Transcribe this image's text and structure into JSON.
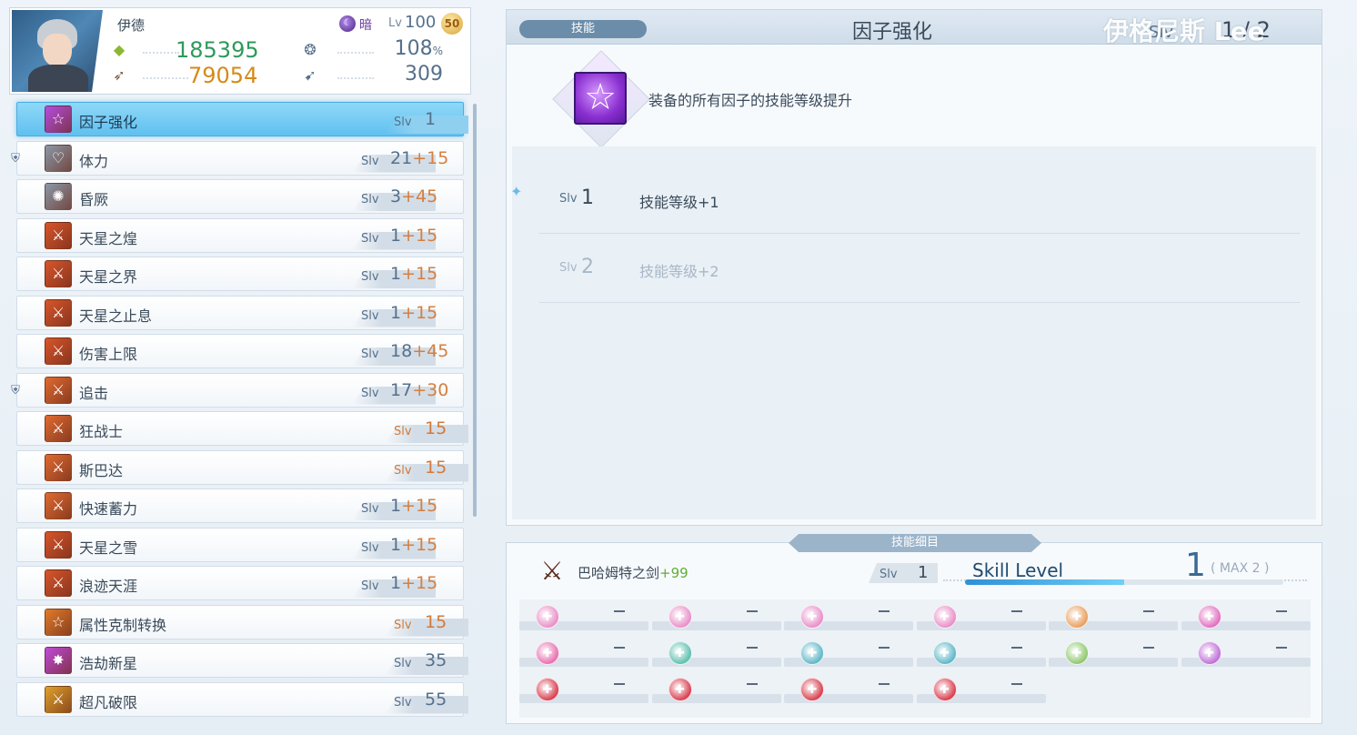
{
  "character": {
    "name": "伊德",
    "element_label": "暗",
    "lv_label": "Lv",
    "level": "100",
    "limit_badge": "50",
    "power": "185395",
    "attack": "79054",
    "crit": "108",
    "crit_unit": "%",
    "speed": "309"
  },
  "skills": [
    {
      "name": "因子强化",
      "slv": "1",
      "bonus": "",
      "icon": "star-icon",
      "icon_color": "#b44de0",
      "locked": false,
      "selected": true,
      "label_color": "gray"
    },
    {
      "name": "体力",
      "slv": "21",
      "bonus": "+15",
      "icon": "heart-icon",
      "icon_color": "#8a98a8",
      "locked": true,
      "selected": false,
      "label_color": "gray"
    },
    {
      "name": "昏厥",
      "slv": "3",
      "bonus": "+45",
      "icon": "stun-icon",
      "icon_color": "#8a98a8",
      "locked": false,
      "selected": false,
      "label_color": "gray"
    },
    {
      "name": "天星之煌",
      "slv": "1",
      "bonus": "+15",
      "icon": "sword-icon",
      "icon_color": "#d8552a",
      "locked": false,
      "selected": false,
      "label_color": "gray"
    },
    {
      "name": "天星之界",
      "slv": "1",
      "bonus": "+15",
      "icon": "sword-icon",
      "icon_color": "#d8552a",
      "locked": false,
      "selected": false,
      "label_color": "gray"
    },
    {
      "name": "天星之止息",
      "slv": "1",
      "bonus": "+15",
      "icon": "sword-icon",
      "icon_color": "#d8552a",
      "locked": false,
      "selected": false,
      "label_color": "gray"
    },
    {
      "name": "伤害上限",
      "slv": "18",
      "bonus": "+45",
      "icon": "sword-icon",
      "icon_color": "#d8552a",
      "locked": false,
      "selected": false,
      "label_color": "gray"
    },
    {
      "name": "追击",
      "slv": "17",
      "bonus": "+30",
      "icon": "sword-icon",
      "icon_color": "#e06a30",
      "locked": true,
      "selected": false,
      "label_color": "gray"
    },
    {
      "name": "狂战士",
      "slv": "15",
      "bonus": "",
      "icon": "sword-icon",
      "icon_color": "#e06a30",
      "locked": false,
      "selected": false,
      "label_color": "orange"
    },
    {
      "name": "斯巴达",
      "slv": "15",
      "bonus": "",
      "icon": "sword-icon",
      "icon_color": "#e06a30",
      "locked": false,
      "selected": false,
      "label_color": "orange"
    },
    {
      "name": "快速蓄力",
      "slv": "1",
      "bonus": "+15",
      "icon": "sword-icon",
      "icon_color": "#e06a30",
      "locked": false,
      "selected": false,
      "label_color": "gray"
    },
    {
      "name": "天星之雪",
      "slv": "1",
      "bonus": "+15",
      "icon": "sword-icon",
      "icon_color": "#d8552a",
      "locked": false,
      "selected": false,
      "label_color": "gray"
    },
    {
      "name": "浪迹天涯",
      "slv": "1",
      "bonus": "+15",
      "icon": "sword-icon",
      "icon_color": "#d8552a",
      "locked": false,
      "selected": false,
      "label_color": "gray"
    },
    {
      "name": "属性克制转换",
      "slv": "15",
      "bonus": "",
      "icon": "star-icon",
      "icon_color": "#e07a2a",
      "locked": false,
      "selected": false,
      "label_color": "orange"
    },
    {
      "name": "浩劫新星",
      "slv": "35",
      "bonus": "",
      "icon": "burst-icon",
      "icon_color": "#c04ad8",
      "locked": false,
      "selected": false,
      "label_color": "gray"
    },
    {
      "name": "超凡破限",
      "slv": "55",
      "bonus": "",
      "icon": "sword-icon",
      "icon_color": "#e0a02a",
      "locked": false,
      "selected": false,
      "label_color": "gray"
    }
  ],
  "detail": {
    "tab": "技能",
    "title": "因子强化",
    "watermark": "伊格尼斯 Lee",
    "slv_label": "Slv",
    "count": "1 / 2",
    "description": "装备的所有因子的技能等级提升",
    "levels": [
      {
        "slv_label": "Slv",
        "num": "1",
        "desc": "技能等级+1",
        "active": true
      },
      {
        "slv_label": "Slv",
        "num": "2",
        "desc": "技能等级+2",
        "active": false
      }
    ]
  },
  "breakdown": {
    "tab": "技能细目",
    "weapon_name": "巴哈姆特之剑",
    "weapon_plus": "+99",
    "slv_label": "Slv",
    "slv_value": "1",
    "skill_level_label": "Skill Level",
    "skill_level": "1",
    "max_text": "( MAX  2 )",
    "progress": 0.5,
    "factor_rows": [
      [
        {
          "icon": "factor-pink-icon",
          "color": "#e890c8",
          "value": "—"
        },
        {
          "icon": "factor-pink-icon",
          "color": "#e890c8",
          "value": "—"
        },
        {
          "icon": "factor-pink-icon",
          "color": "#e890c8",
          "value": "—"
        },
        {
          "icon": "factor-pink-icon",
          "color": "#e890c8",
          "value": "—"
        },
        {
          "icon": "factor-crown-icon",
          "color": "#e8a060",
          "value": "—"
        },
        {
          "icon": "factor-pink-icon",
          "color": "#e070c0",
          "value": "—"
        }
      ],
      [
        {
          "icon": "factor-pink-icon",
          "color": "#e870b0",
          "value": "—"
        },
        {
          "icon": "factor-teal-icon",
          "color": "#60c0b0",
          "value": "—"
        },
        {
          "icon": "factor-teal-icon",
          "color": "#60b8c8",
          "value": "—"
        },
        {
          "icon": "factor-teal-icon",
          "color": "#60b8c8",
          "value": "—"
        },
        {
          "icon": "factor-teal-icon",
          "color": "#90c870",
          "value": "—"
        },
        {
          "icon": "factor-star-icon",
          "color": "#c070d8",
          "value": "—"
        }
      ],
      [
        {
          "icon": "factor-red-icon",
          "color": "#d84050",
          "value": "—"
        },
        {
          "icon": "factor-red-icon",
          "color": "#d84050",
          "value": "—"
        },
        {
          "icon": "factor-red-icon",
          "color": "#d84050",
          "value": "—"
        },
        {
          "icon": "factor-red-icon",
          "color": "#d84050",
          "value": "—"
        }
      ]
    ]
  }
}
